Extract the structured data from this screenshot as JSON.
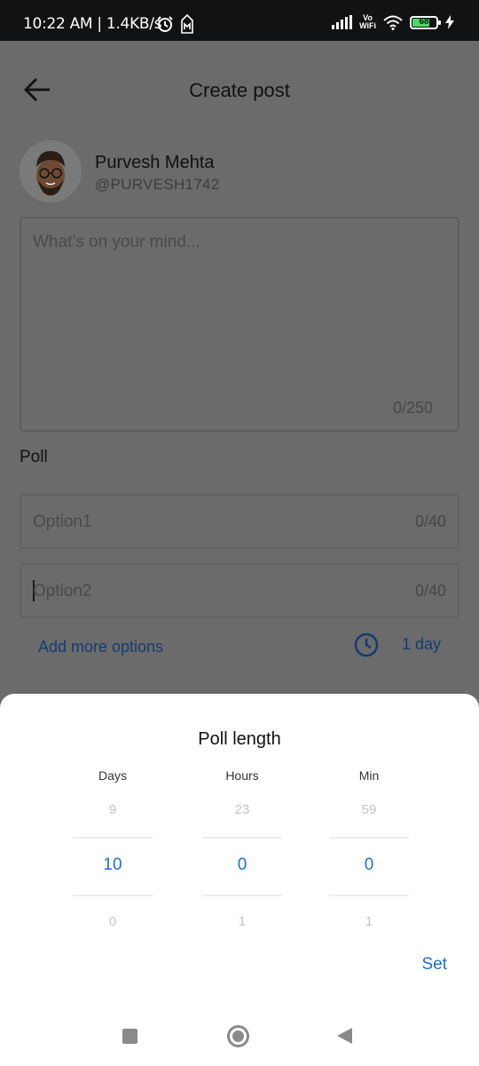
{
  "status_bar": {
    "time": "10:22 AM | 1.4KB/s",
    "vowifi_top": "Vo",
    "vowifi_bottom": "WiFi",
    "battery_level": "68",
    "icons": [
      "alarm-icon",
      "sim-icon",
      "signal-icon",
      "vowifi-icon",
      "wifi-icon",
      "battery-icon",
      "charging-icon"
    ]
  },
  "header": {
    "title": "Create post",
    "back_icon": "arrow-left-icon"
  },
  "user": {
    "name": "Purvesh Mehta",
    "handle": "@PURVESH1742"
  },
  "composer": {
    "placeholder": "What’s on your mind...",
    "count": "0/250"
  },
  "poll": {
    "label": "Poll",
    "options": [
      {
        "placeholder": "Option1",
        "count": "0/40"
      },
      {
        "placeholder": "Option2",
        "count": "0/40"
      }
    ],
    "add_more": "Add more options",
    "duration": "1 day",
    "duration_icon": "clock-icon"
  },
  "poll_length_sheet": {
    "title": "Poll length",
    "columns": [
      {
        "header": "Days",
        "prev": "9",
        "selected": "10",
        "next": "0"
      },
      {
        "header": "Hours",
        "prev": "23",
        "selected": "0",
        "next": "1"
      },
      {
        "header": "Min",
        "prev": "59",
        "selected": "0",
        "next": "1"
      }
    ],
    "set_label": "Set"
  },
  "colors": {
    "accent": "#1f6fcf",
    "link_dimmed": "#153a73",
    "scrim": "#6b6b6b",
    "status_bar": "#111214"
  },
  "nav_bar": {
    "icons": [
      "recent-apps-icon",
      "home-icon",
      "back-icon"
    ]
  }
}
